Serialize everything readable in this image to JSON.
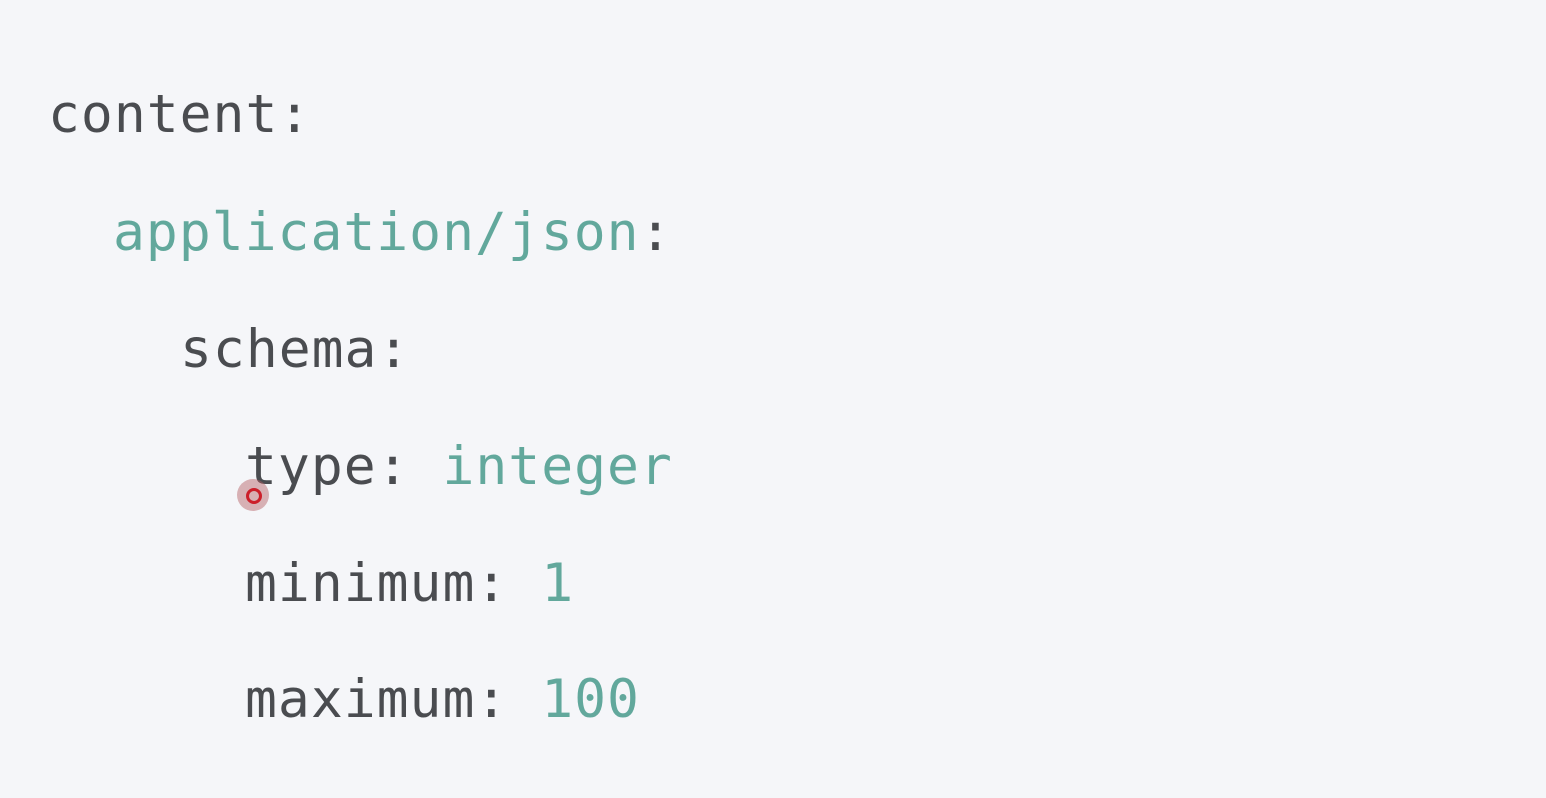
{
  "code": {
    "lines": [
      {
        "key": "content",
        "sep": ":",
        "value": ""
      },
      {
        "key": "application/json",
        "sep": ":",
        "value": ""
      },
      {
        "key": "schema",
        "sep": ":",
        "value": ""
      },
      {
        "key": "type",
        "sep": ": ",
        "value": "integer"
      },
      {
        "key": "minimum",
        "sep": ": ",
        "value": "1"
      },
      {
        "key": "maximum",
        "sep": ": ",
        "value": "100"
      }
    ]
  },
  "colors": {
    "background": "#f5f6f9",
    "key": "#4a4c50",
    "accent": "#62a89c",
    "cursor": "#cc1f2a"
  },
  "icons": {
    "cursor": "click-cursor-indicator-icon"
  }
}
